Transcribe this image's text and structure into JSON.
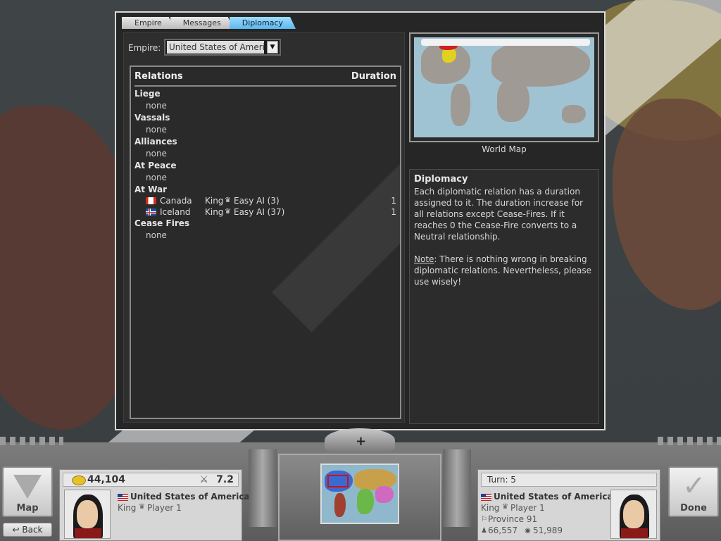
{
  "tabs": [
    {
      "label": "Empire",
      "active": false
    },
    {
      "label": "Messages",
      "active": false
    },
    {
      "label": "Diplomacy",
      "active": true
    }
  ],
  "empire_select": {
    "label": "Empire:",
    "value": "United States of America"
  },
  "relations": {
    "header": "Relations",
    "duration_header": "Duration",
    "categories": [
      {
        "name": "Liege",
        "none": "none"
      },
      {
        "name": "Vassals",
        "none": "none"
      },
      {
        "name": "Alliances",
        "none": "none"
      },
      {
        "name": "At Peace",
        "none": "none"
      },
      {
        "name": "At War",
        "none": ""
      },
      {
        "name": "Cease Fires",
        "none": "none"
      }
    ],
    "war": [
      {
        "country": "Canada",
        "title": "King",
        "ai": "Easy AI (3)",
        "duration": "1",
        "flag": "canada"
      },
      {
        "country": "Iceland",
        "title": "King",
        "ai": "Easy AI (37)",
        "duration": "1",
        "flag": "iceland"
      }
    ]
  },
  "world_map": {
    "caption": "World Map"
  },
  "info": {
    "title": "Diplomacy",
    "text": "Each diplomatic relation has a duration assigned to it. The duration increase for all relations except Cease-Fires. If it reaches 0 the Cease-Fire converts to a Neutral relationship.",
    "note_label": "Note",
    "note_text": ": There is nothing wrong in breaking diplomatic relations. Nevertheless, please use wisely!"
  },
  "hud": {
    "map_button": "Map",
    "back_button": "↩ Back",
    "done_button": "Done",
    "gold": "44,104",
    "military": "7.2",
    "left_player": {
      "country": "United States of America",
      "title": "King",
      "player": "Player 1"
    },
    "turn": "Turn: 5",
    "right_player": {
      "country": "United States of America",
      "title": "King",
      "player": "Player 1",
      "province": "Province 91",
      "stat1": "66,557",
      "stat2": "51,989"
    }
  },
  "colors": {
    "tab_active": "#5cb8ee",
    "dialog_bg": "#262626",
    "war_flag_canada": "#d52b1e"
  }
}
